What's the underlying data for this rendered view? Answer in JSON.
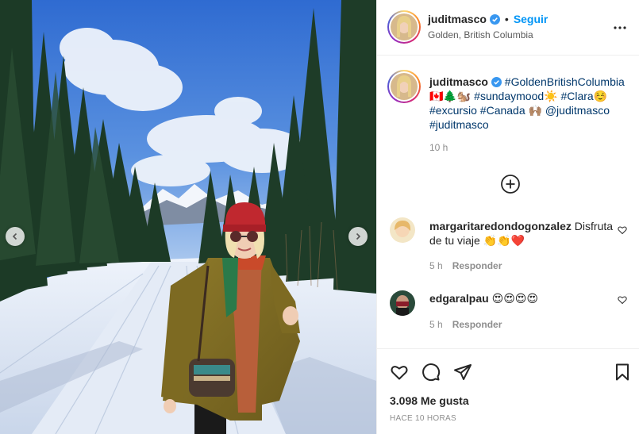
{
  "post": {
    "author": "juditmasco",
    "follow_label": "Seguir",
    "separator": "•",
    "location": "Golden, British Columbia"
  },
  "caption": {
    "author": "juditmasco",
    "line1": " #GoldenBritishColumbia",
    "line2": "🇨🇦🌲🐿️ #sundaymood☀️ #Clara☺️",
    "line3": "#excursio #Canada 🙌🏽 @juditmasco",
    "line4": "#juditmasco",
    "time": "10 h"
  },
  "comments": [
    {
      "author": "margaritaredondogonzalez",
      "text": " Disfruta de tu viaje 👏👏❤️",
      "time": "5 h",
      "reply_label": "Responder"
    },
    {
      "author": "edgaralpau",
      "text": " 😍😍😍😍",
      "time": "5 h",
      "reply_label": "Responder"
    }
  ],
  "stats": {
    "likes": "3.098 Me gusta",
    "posted": "HACE 10 HORAS"
  },
  "icons": {
    "verified": "verified-badge-icon",
    "more": "more-options-icon",
    "load_more": "plus-circle-icon",
    "like": "heart-icon",
    "comment": "comment-icon",
    "share": "send-icon",
    "save": "bookmark-icon",
    "prev": "chevron-left-icon",
    "next": "chevron-right-icon"
  },
  "colors": {
    "follow": "#0095f6",
    "hashtag": "#00376b",
    "verified": "#3897f0",
    "muted": "#8e8e8e"
  }
}
